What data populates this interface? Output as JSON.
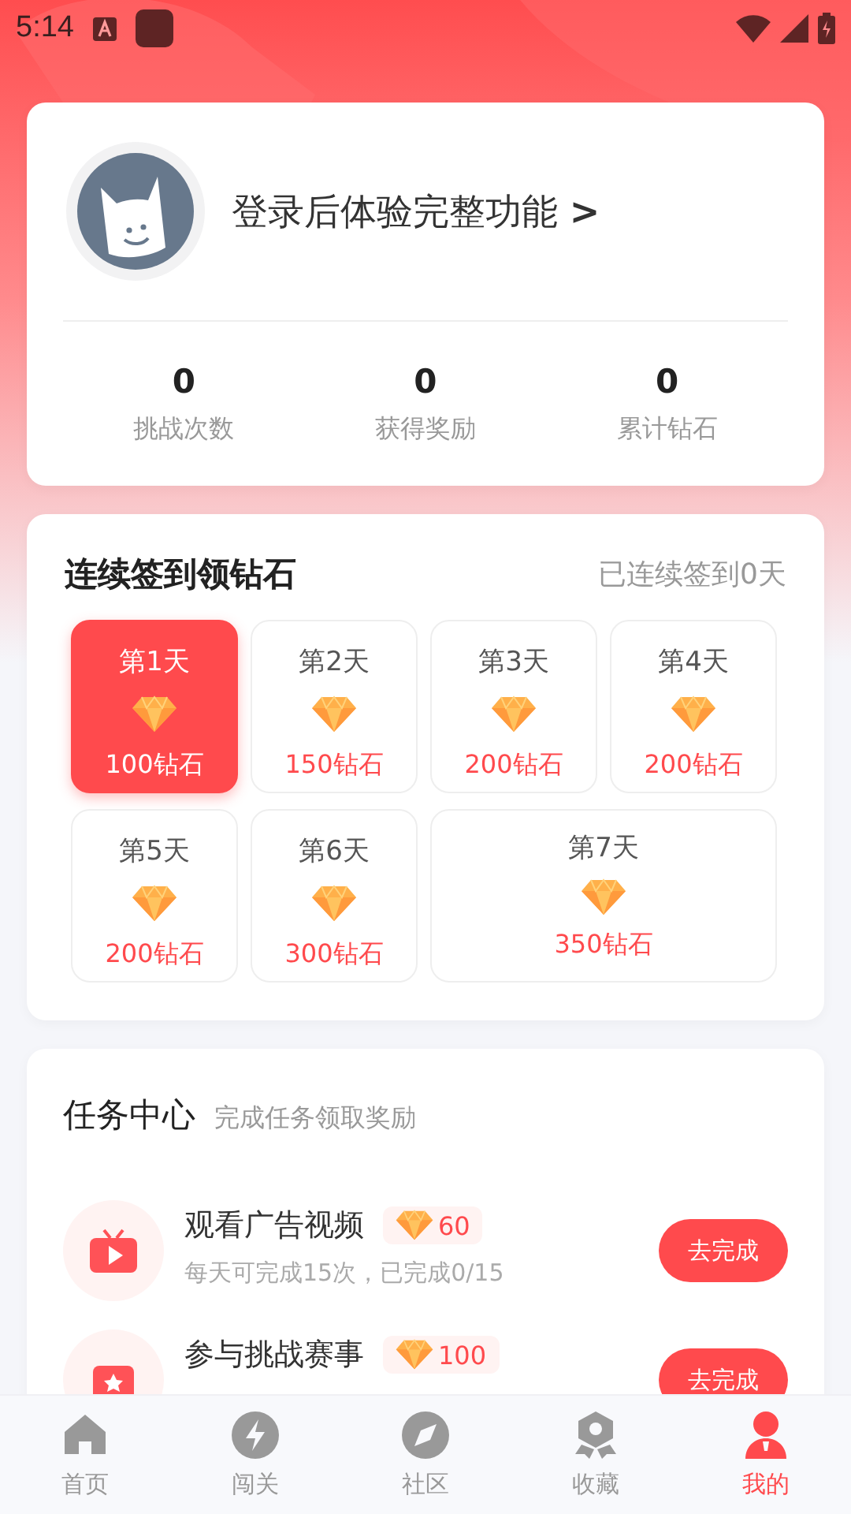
{
  "status_bar": {
    "time": "5:14"
  },
  "profile": {
    "login_prompt": "登录后体验完整功能",
    "arrow": ">",
    "stats": [
      {
        "value": "0",
        "label": "挑战次数"
      },
      {
        "value": "0",
        "label": "获得奖励"
      },
      {
        "value": "0",
        "label": "累计钻石"
      }
    ]
  },
  "checkin": {
    "title": "连续签到领钻石",
    "streak": "已连续签到0天",
    "days": [
      {
        "label": "第1天",
        "reward": "100钻石",
        "selected": true
      },
      {
        "label": "第2天",
        "reward": "150钻石",
        "selected": false
      },
      {
        "label": "第3天",
        "reward": "200钻石",
        "selected": false
      },
      {
        "label": "第4天",
        "reward": "200钻石",
        "selected": false
      },
      {
        "label": "第5天",
        "reward": "200钻石",
        "selected": false
      },
      {
        "label": "第6天",
        "reward": "300钻石",
        "selected": false
      },
      {
        "label": "第7天",
        "reward": "350钻石",
        "selected": false
      }
    ]
  },
  "tasks": {
    "title": "任务中心",
    "subtitle": "完成任务领取奖励",
    "items": [
      {
        "kind": "video",
        "title": "观看广告视频",
        "reward": "60",
        "detail": "每天可完成15次，已完成0/15",
        "button": "去完成"
      },
      {
        "kind": "contest",
        "title": "参与挑战赛事",
        "reward": "100",
        "button": "去完成"
      }
    ]
  },
  "nav": [
    {
      "kind": "home",
      "label": "首页",
      "selected": false
    },
    {
      "kind": "bolt",
      "label": "闯关",
      "selected": false
    },
    {
      "kind": "compass",
      "label": "社区",
      "selected": false
    },
    {
      "kind": "badge",
      "label": "收藏",
      "selected": false
    },
    {
      "kind": "person",
      "label": "我的",
      "selected": true
    }
  ]
}
